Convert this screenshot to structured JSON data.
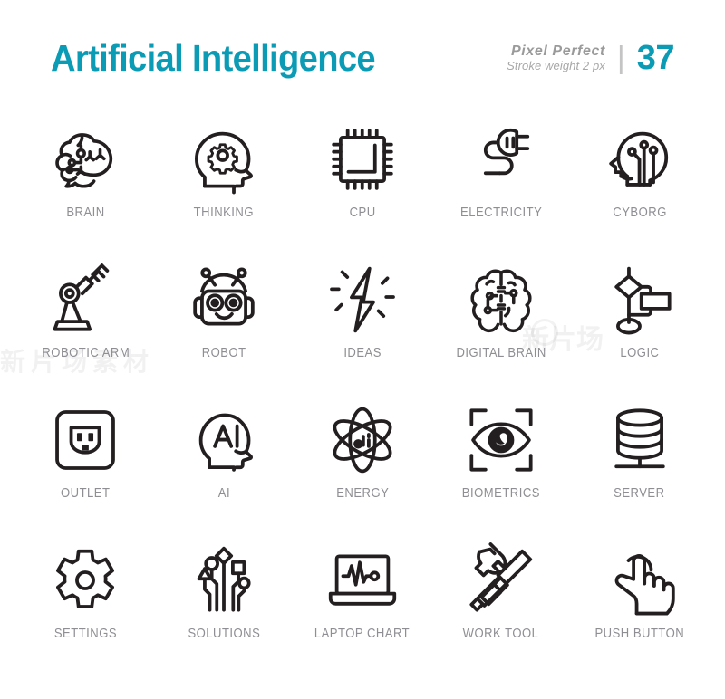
{
  "header": {
    "title": "Artificial Intelligence",
    "pixel_perfect_label": "Pixel  Perfect",
    "stroke_weight_label": "Stroke weight 2 px",
    "divider": "|",
    "count": "37",
    "accent_color": "#0b9bb5",
    "label_color": "#8e8e93",
    "stroke_color": "#231f20",
    "background_color": "#ffffff"
  },
  "icons": [
    {
      "label": "BRAIN",
      "icon": "brain-icon"
    },
    {
      "label": "THINKING",
      "icon": "head-gear-icon"
    },
    {
      "label": "CPU",
      "icon": "cpu-chip-icon"
    },
    {
      "label": "ELECTRICITY",
      "icon": "power-plug-icon"
    },
    {
      "label": "CYBORG",
      "icon": "cyborg-head-icon"
    },
    {
      "label": "ROBOTIC ARM",
      "icon": "robotic-arm-icon"
    },
    {
      "label": "ROBOT",
      "icon": "robot-head-icon"
    },
    {
      "label": "IDEAS",
      "icon": "lightning-bolt-icon"
    },
    {
      "label": "DIGITAL BRAIN",
      "icon": "digital-brain-icon"
    },
    {
      "label": "LOGIC",
      "icon": "flowchart-icon"
    },
    {
      "label": "OUTLET",
      "icon": "power-outlet-icon"
    },
    {
      "label": "AI",
      "icon": "ai-head-icon"
    },
    {
      "label": "ENERGY",
      "icon": "atom-icon"
    },
    {
      "label": "BIOMETRICS",
      "icon": "eye-scan-icon"
    },
    {
      "label": "SERVER",
      "icon": "database-server-icon"
    },
    {
      "label": "SETTINGS",
      "icon": "gear-icon"
    },
    {
      "label": "SOLUTIONS",
      "icon": "circuit-nodes-icon"
    },
    {
      "label": "LAPTOP CHART",
      "icon": "laptop-pulse-icon"
    },
    {
      "label": "WORK TOOL",
      "icon": "hammer-screwdriver-icon"
    },
    {
      "label": "PUSH BUTTON",
      "icon": "hand-tap-icon"
    }
  ],
  "watermark": {
    "text_a": "新片场",
    "text_b": "素材",
    "text_c": "新片场素材"
  }
}
